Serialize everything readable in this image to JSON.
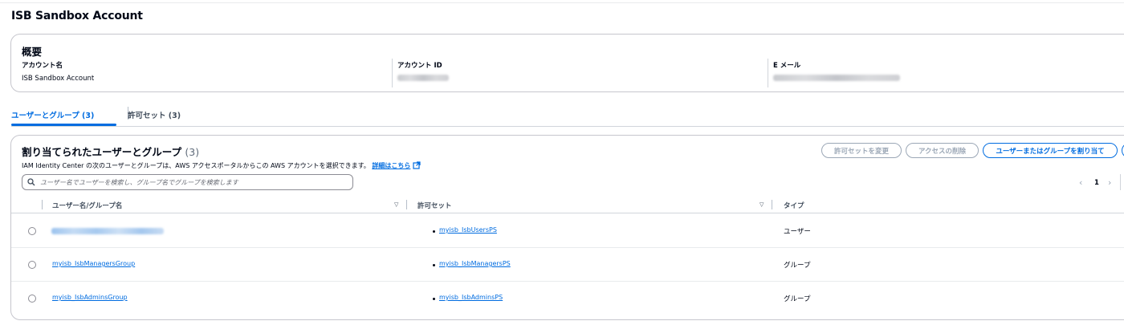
{
  "page": {
    "title": "ISB Sandbox Account"
  },
  "overview": {
    "title": "概要",
    "account_name_label": "アカウント名",
    "account_name_value": "ISB Sandbox Account",
    "account_id_label": "アカウント ID",
    "email_label": "E メール"
  },
  "tabs": [
    {
      "label": "ユーザーとグループ (3)",
      "active": true
    },
    {
      "label": "許可セット (3)",
      "active": false
    }
  ],
  "table": {
    "title": "割り当てられたユーザーとグループ",
    "count": "(3)",
    "description": "IAM Identity Center の次のユーザーとグループは、AWS アクセスポータルからこの AWS アカウントを選択できます。",
    "learn_more": "詳細はこちら",
    "search_placeholder": "ユーザー名でユーザーを検索し、グループ名でグループを検索します",
    "buttons": {
      "change_permission_set": "許可セットを変更",
      "remove_access": "アクセスの削除",
      "assign": "ユーザーまたはグループを割り当て"
    },
    "pagination": {
      "prev": "‹",
      "page": "1",
      "next": "›"
    },
    "columns": [
      "ユーザー名/グループ名",
      "許可セット",
      "タイプ"
    ],
    "rows": [
      {
        "name": "",
        "permission_set": "myisb_IsbUsersPS",
        "type": "ユーザー"
      },
      {
        "name": "myisb_IsbManagersGroup",
        "permission_set": "myisb_IsbManagersPS",
        "type": "グループ"
      },
      {
        "name": "myisb_IsbAdminsGroup",
        "permission_set": "myisb_IsbAdminsPS",
        "type": "グループ"
      }
    ]
  },
  "colors": {
    "accent": "#006ce0",
    "text": "#000716",
    "disabled": "#9ba7b6",
    "border": "#c6c6cd"
  },
  "icons": [
    "external-link-icon",
    "search-icon",
    "sort-icon",
    "chevron-left-icon",
    "chevron-right-icon"
  ]
}
